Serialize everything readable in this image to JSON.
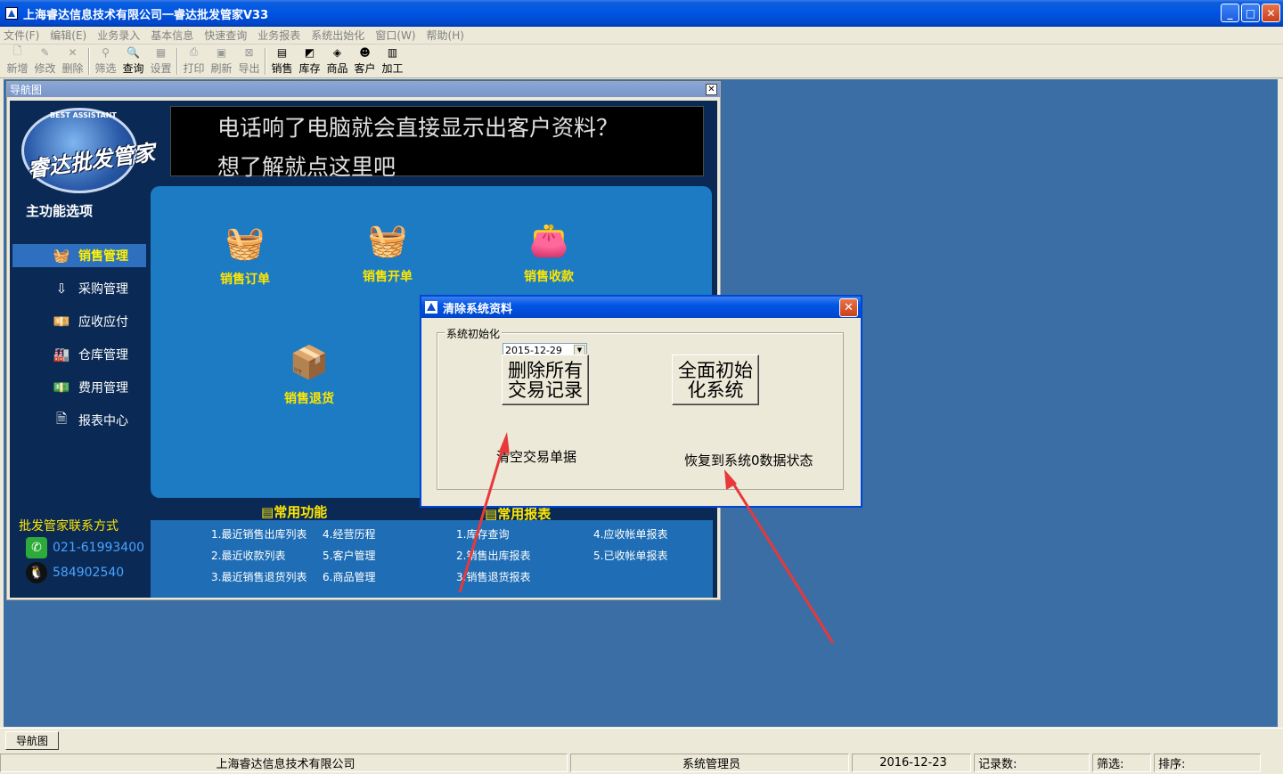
{
  "window": {
    "title": "上海睿达信息技术有限公司一睿达批发管家V33"
  },
  "menu": [
    "文件(F)",
    "编辑(E)",
    "业务录入",
    "基本信息",
    "快速查询",
    "业务报表",
    "系统出始化",
    "窗口(W)",
    "帮助(H)"
  ],
  "toolbar": {
    "group1": [
      {
        "label": "新增",
        "icon": "new-doc-icon",
        "glyph": "🗋",
        "enabled": false
      },
      {
        "label": "修改",
        "icon": "edit-icon",
        "glyph": "✎",
        "enabled": false
      },
      {
        "label": "删除",
        "icon": "delete-icon",
        "glyph": "✕",
        "enabled": false
      }
    ],
    "group2": [
      {
        "label": "筛选",
        "icon": "filter-icon",
        "glyph": "⚲",
        "enabled": false
      },
      {
        "label": "查询",
        "icon": "search-icon",
        "glyph": "🔍",
        "enabled": true
      },
      {
        "label": "设置",
        "icon": "settings-icon",
        "glyph": "▦",
        "enabled": false
      }
    ],
    "group3": [
      {
        "label": "打印",
        "icon": "print-icon",
        "glyph": "⎙",
        "enabled": false
      },
      {
        "label": "刷新",
        "icon": "refresh-icon",
        "glyph": "▣",
        "enabled": false
      },
      {
        "label": "导出",
        "icon": "export-icon",
        "glyph": "⊠",
        "enabled": false
      }
    ],
    "group4": [
      {
        "label": "销售",
        "icon": "sales-icon",
        "glyph": "▤",
        "enabled": true
      },
      {
        "label": "库存",
        "icon": "inventory-icon",
        "glyph": "◩",
        "enabled": true
      },
      {
        "label": "商品",
        "icon": "product-icon",
        "glyph": "◈",
        "enabled": true
      },
      {
        "label": "客户",
        "icon": "customer-icon",
        "glyph": "☻",
        "enabled": true
      },
      {
        "label": "加工",
        "icon": "process-icon",
        "glyph": "▥",
        "enabled": true
      }
    ]
  },
  "nav": {
    "title": "导航图",
    "logo_text": "睿达批发管家",
    "logo_badge": "BEST ASSISTANT",
    "banner": {
      "line1": "电话响了电脑就会直接显示出客户资料？",
      "line2": "想了解就点这里吧"
    },
    "sidebar_title": "主功能选项",
    "sidebar": [
      {
        "label": "销售管理",
        "icon": "basket-icon",
        "glyph": "🧺"
      },
      {
        "label": "采购管理",
        "icon": "purchase-icon",
        "glyph": "⇩"
      },
      {
        "label": "应收应付",
        "icon": "money-icon",
        "glyph": "💴"
      },
      {
        "label": "仓库管理",
        "icon": "warehouse-icon",
        "glyph": "🏭"
      },
      {
        "label": "费用管理",
        "icon": "expense-icon",
        "glyph": "💵"
      },
      {
        "label": "报表中心",
        "icon": "report-icon",
        "glyph": "🗎"
      }
    ],
    "functions": [
      {
        "label": "销售订单",
        "icon": "order-basket-icon",
        "glyph": "🧺"
      },
      {
        "label": "销售开单",
        "icon": "invoice-basket-icon",
        "glyph": "🧺"
      },
      {
        "label": "销售收款",
        "icon": "wallet-icon",
        "glyph": "👛"
      },
      {
        "label": "销售退货",
        "icon": "return-cart-icon",
        "glyph": "📦"
      }
    ],
    "common_title": "常用功能",
    "report_title": "常用报表",
    "common_links": [
      "1.最近销售出库列表",
      "2.最近收款列表",
      "3.最近销售退货列表",
      "4.经营历程",
      "5.客户管理",
      "6.商品管理"
    ],
    "report_links": [
      "1.库存查询",
      "2.销售出库报表",
      "3.销售退货报表",
      "4.应收帐单报表",
      "5.已收帐单报表"
    ],
    "contact_title": "批发管家联系方式",
    "phone": "021-61993400",
    "qq": "584902540"
  },
  "dialog": {
    "title": "清除系统资料",
    "group_label": "系统初始化",
    "date": "2015-12-29",
    "delete_button": "删除所有交易记录",
    "reset_button": "全面初始化系统",
    "delete_caption": "清空交易单据",
    "reset_caption": "恢复到系统0数据状态"
  },
  "taskbar": {
    "tab": "导航图"
  },
  "status": {
    "company": "上海睿达信息技术有限公司",
    "user": "系统管理员",
    "date": "2016-12-23",
    "records": "记录数:",
    "filter": "筛选:",
    "sort": "排序:"
  },
  "colors": {
    "annotation_arrow": "#e8383a",
    "mdi_bg": "#3a6ea5",
    "title_blue": "#0054e3"
  }
}
